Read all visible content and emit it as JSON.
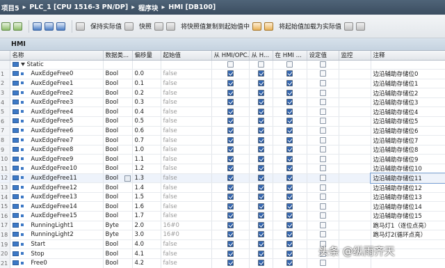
{
  "breadcrumb": [
    "项目5",
    "PLC_1 [CPU 1516-3 PN/DP]",
    "程序块",
    "HMI [DB100]"
  ],
  "toolbar": {
    "keep_actual": "保持实际值",
    "snapshot": "快照",
    "copy_snapshot": "将快照值复制到起始值中",
    "load_start": "将起始值加载为实际值"
  },
  "block_title": "HMI",
  "columns": [
    "名称",
    "数据类...",
    "偏移量",
    "起始值",
    "从 HMI/OPC...",
    "从 H...",
    "在 HMI ...",
    "设定值",
    "监控",
    "注释"
  ],
  "static_label": "Static",
  "rows": [
    {
      "n": "1",
      "name": "AuxEdgeFree0",
      "type": "Bool",
      "off": "0.0",
      "start": "false",
      "comment": "边沿辅助存储位0"
    },
    {
      "n": "2",
      "name": "AuxEdgeFree1",
      "type": "Bool",
      "off": "0.1",
      "start": "false",
      "comment": "边沿辅助存储位1"
    },
    {
      "n": "3",
      "name": "AuxEdgeFree2",
      "type": "Bool",
      "off": "0.2",
      "start": "false",
      "comment": "边沿辅助存储位2"
    },
    {
      "n": "4",
      "name": "AuxEdgeFree3",
      "type": "Bool",
      "off": "0.3",
      "start": "false",
      "comment": "边沿辅助存储位3"
    },
    {
      "n": "5",
      "name": "AuxEdgeFree4",
      "type": "Bool",
      "off": "0.4",
      "start": "false",
      "comment": "边沿辅助存储位4"
    },
    {
      "n": "6",
      "name": "AuxEdgeFree5",
      "type": "Bool",
      "off": "0.5",
      "start": "false",
      "comment": "边沿辅助存储位5"
    },
    {
      "n": "7",
      "name": "AuxEdgeFree6",
      "type": "Bool",
      "off": "0.6",
      "start": "false",
      "comment": "边沿辅助存储位6"
    },
    {
      "n": "8",
      "name": "AuxEdgeFree7",
      "type": "Bool",
      "off": "0.7",
      "start": "false",
      "comment": "边沿辅助存储位7"
    },
    {
      "n": "9",
      "name": "AuxEdgeFree8",
      "type": "Bool",
      "off": "1.0",
      "start": "false",
      "comment": "边沿辅助存储位8"
    },
    {
      "n": "10",
      "name": "AuxEdgeFree9",
      "type": "Bool",
      "off": "1.1",
      "start": "false",
      "comment": "边沿辅助存储位9"
    },
    {
      "n": "11",
      "name": "AuxEdgeFree10",
      "type": "Bool",
      "off": "1.2",
      "start": "false",
      "comment": "边沿辅助存储位10"
    },
    {
      "n": "12",
      "name": "AuxEdgeFree11",
      "type": "Bool",
      "off": "1.3",
      "start": "false",
      "comment": "边沿辅助存储位11"
    },
    {
      "n": "13",
      "name": "AuxEdgeFree12",
      "type": "Bool",
      "off": "1.4",
      "start": "false",
      "comment": "边沿辅助存储位12"
    },
    {
      "n": "14",
      "name": "AuxEdgeFree13",
      "type": "Bool",
      "off": "1.5",
      "start": "false",
      "comment": "边沿辅助存储位13"
    },
    {
      "n": "15",
      "name": "AuxEdgeFree14",
      "type": "Bool",
      "off": "1.6",
      "start": "false",
      "comment": "边沿辅助存储位14"
    },
    {
      "n": "16",
      "name": "AuxEdgeFree15",
      "type": "Bool",
      "off": "1.7",
      "start": "false",
      "comment": "边沿辅助存储位15"
    },
    {
      "n": "17",
      "name": "RunningLight1",
      "type": "Byte",
      "off": "2.0",
      "start": "16#0",
      "comment": "跑马灯1（逐位点亮）"
    },
    {
      "n": "18",
      "name": "RunningLight2",
      "type": "Byte",
      "off": "3.0",
      "start": "16#0",
      "comment": "跑马灯2(循环点亮）"
    },
    {
      "n": "19",
      "name": "Start",
      "type": "Bool",
      "off": "4.0",
      "start": "false",
      "comment": ""
    },
    {
      "n": "20",
      "name": "Stop",
      "type": "Bool",
      "off": "4.1",
      "start": "false",
      "comment": ""
    },
    {
      "n": "21",
      "name": "Free0",
      "type": "Bool",
      "off": "4.2",
      "start": "false",
      "comment": ""
    }
  ],
  "watermark": "头条 @纵雨齐天"
}
